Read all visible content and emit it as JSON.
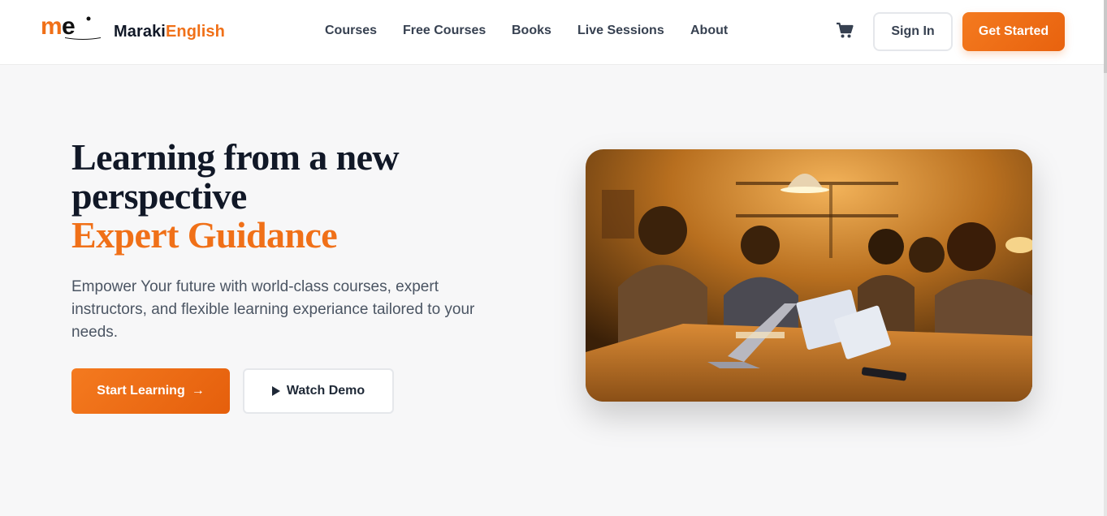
{
  "header": {
    "brand_part1": "Maraki",
    "brand_part2": "English",
    "logo_text": "me",
    "nav": [
      "Courses",
      "Free Courses",
      "Books",
      "Live Sessions",
      "About"
    ],
    "signin_label": "Sign In",
    "getstarted_label": "Get Started"
  },
  "hero": {
    "title": "Learning from a new perspective",
    "accent": "Expert Guidance",
    "description": "Empower Your future with world-class courses, expert instructors, and flexible learning experiance tailored to your needs.",
    "start_label": "Start Learning",
    "demo_label": "Watch Demo"
  },
  "icons": {
    "cart": "cart-icon",
    "arrow": "arrow-right-icon",
    "play": "play-icon"
  },
  "colors": {
    "accent": "#f07018",
    "text_dark": "#111827",
    "text_muted": "#4b5563",
    "background": "#f7f7f8"
  }
}
